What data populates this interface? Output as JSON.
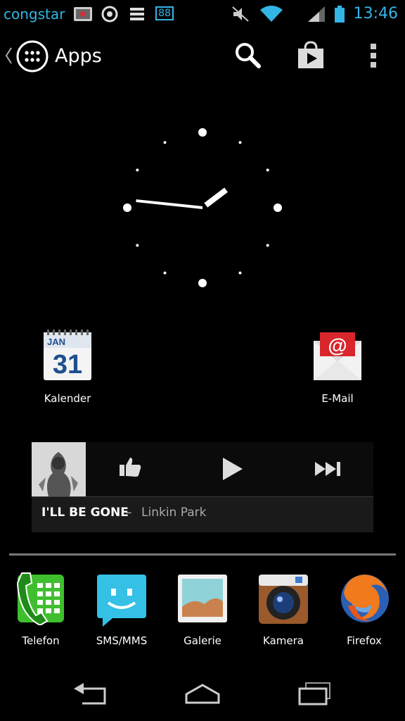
{
  "status_bar": {
    "carrier": "congstar",
    "time": "13:46",
    "battery_level_icon_text": "88",
    "icons": [
      "picture-notification-icon",
      "sync-notification-icon",
      "list-notification-icon",
      "battery-88-notification-icon",
      "mute-icon",
      "wifi-icon",
      "signal-icon",
      "battery-icon"
    ]
  },
  "action_bar": {
    "title": "Apps",
    "icons": [
      "back-caret-icon",
      "apps-grid-icon",
      "search-icon",
      "play-store-icon",
      "overflow-menu-icon"
    ]
  },
  "clock": {
    "hour": 1,
    "minute": 46
  },
  "home_apps": [
    {
      "label": "Kalender",
      "icon": "calendar-icon",
      "calendar_month": "JAN",
      "calendar_day": "31"
    },
    {
      "label": "E-Mail",
      "icon": "email-icon"
    }
  ],
  "music_widget": {
    "song": "I'LL BE GONE",
    "separator": "–",
    "artist": "Linkin Park",
    "controls": [
      "thumbs-up-icon",
      "play-icon",
      "next-icon"
    ]
  },
  "dock": [
    {
      "label": "Telefon",
      "icon": "phone-icon"
    },
    {
      "label": "SMS/MMS",
      "icon": "sms-icon"
    },
    {
      "label": "Galerie",
      "icon": "gallery-icon"
    },
    {
      "label": "Kamera",
      "icon": "camera-icon"
    },
    {
      "label": "Firefox",
      "icon": "firefox-icon"
    }
  ],
  "nav_bar": [
    "back-icon",
    "home-icon",
    "recent-apps-icon"
  ],
  "colors": {
    "accent": "#33b5e5",
    "background": "#000000",
    "widget_background": "#1a1a1a"
  }
}
